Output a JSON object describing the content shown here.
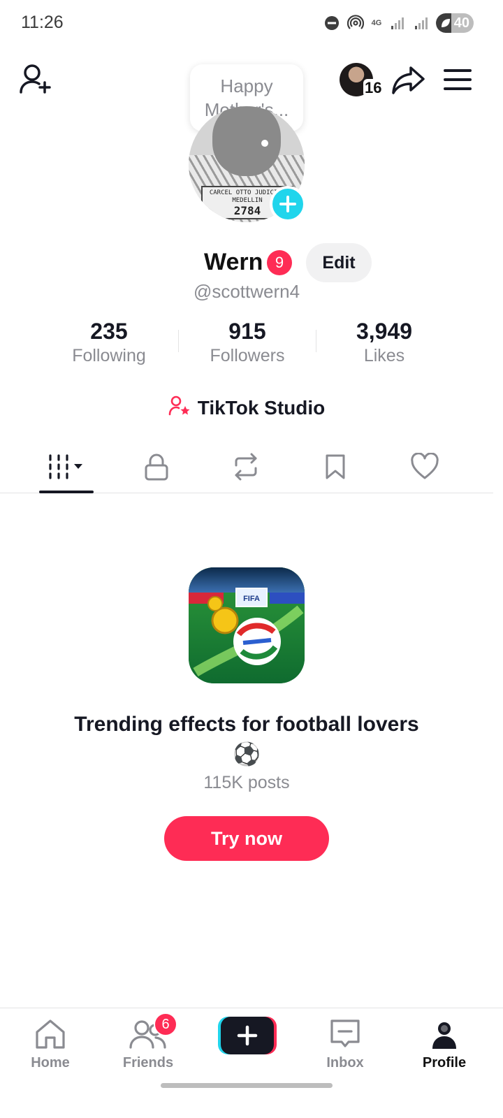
{
  "status_bar": {
    "time": "11:26",
    "network_label": "4G",
    "battery_level": "40",
    "battery_fraction": 0.4
  },
  "header": {
    "story_count": "16",
    "note_text": "Happy Mother's..."
  },
  "profile": {
    "display_name": "Wern",
    "name_badge": "9",
    "edit_label": "Edit",
    "username": "@scottwern4",
    "avatar_sign_line1": "CARCEL OTTO JUDICIAL",
    "avatar_sign_line2": "MEDELLIN",
    "avatar_sign_line3": "2784"
  },
  "stats": [
    {
      "value": "235",
      "label": "Following"
    },
    {
      "value": "915",
      "label": "Followers"
    },
    {
      "value": "3,949",
      "label": "Likes"
    }
  ],
  "studio": {
    "label": "TikTok Studio"
  },
  "tabs": [
    "videos-grid",
    "private",
    "reposts",
    "favorites",
    "liked"
  ],
  "promo": {
    "image_label": "FIFA",
    "title": "Trending effects for football lovers",
    "emoji": "⚽",
    "posts": "115K posts",
    "button": "Try now"
  },
  "nav": {
    "home": "Home",
    "friends": "Friends",
    "friends_badge": "6",
    "inbox": "Inbox",
    "profile": "Profile"
  },
  "colors": {
    "accent": "#fe2c55",
    "cyan": "#20d5ec",
    "text_primary": "#161823",
    "text_secondary": "#8a8b91"
  }
}
